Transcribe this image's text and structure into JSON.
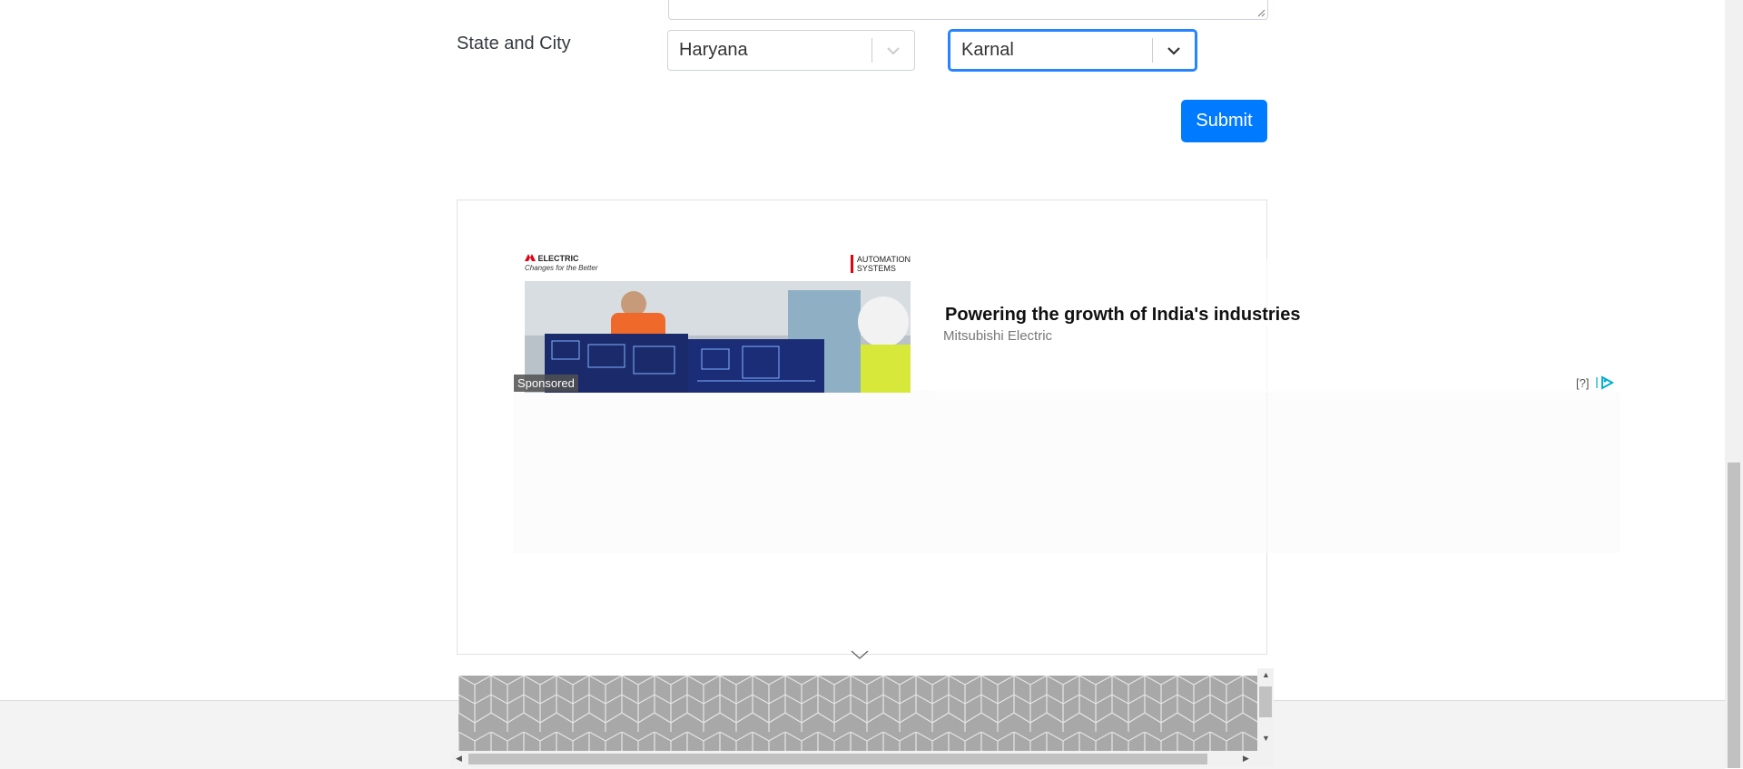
{
  "form": {
    "state_city_label": "State and City",
    "state_select": {
      "value": "Haryana"
    },
    "city_select": {
      "value": "Karnal"
    },
    "submit_label": "Submit"
  },
  "ad": {
    "brand_left": "ELECTRIC",
    "brand_tagline": "Changes for the Better",
    "brand_right_line1": "AUTOMATION",
    "brand_right_line2": "SYSTEMS",
    "sponsored_label": "Sponsored",
    "headline": "Powering the growth of India's industries",
    "advertiser": "Mitsubishi Electric",
    "help_label": "[?]",
    "adchoices_icon": "adchoices-icon"
  },
  "colors": {
    "primary": "#007bff",
    "focus": "#2684ff",
    "brand_red": "#e60012"
  }
}
